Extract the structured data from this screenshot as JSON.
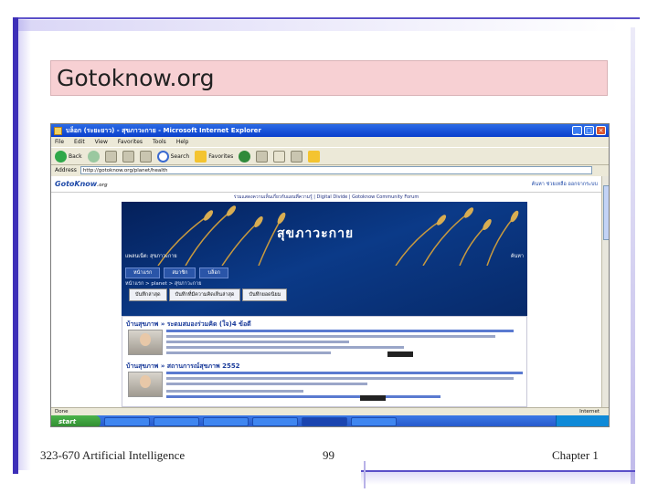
{
  "slide": {
    "title": "Gotoknow.org",
    "footer_left": "323-670 Artificial Intelligence",
    "footer_center": "99",
    "footer_right": "Chapter 1"
  },
  "browser": {
    "window_title": "บล็อก (ระยะยาว) - สุขภาวะกาย - Microsoft Internet Explorer",
    "menu": [
      "File",
      "Edit",
      "View",
      "Favorites",
      "Tools",
      "Help"
    ],
    "toolbar": {
      "back": "Back",
      "search": "Search",
      "favorites": "Favorites"
    },
    "address_label": "Address",
    "address": "http://gotoknow.org/planet/health",
    "status": "Done",
    "status_zone": "Internet",
    "start_label": "start"
  },
  "site": {
    "logo": "GotoKnow",
    "logo_suffix": ".org",
    "header_links": "ค้นหา  ช่วยเหลือ  ออกจากระบบ",
    "announcement": "ร่วมแสดงความเห็นเกี่ยวกับแผนที่ความรู้ | Digital Divide | Gotoknow Community Forum",
    "banner_title": "สุขภาวะกาย",
    "banner_sub": "แพลนเน็ต: สุขภาวะกาย",
    "banner_right": "ค้นหา",
    "nav": [
      "หน้าแรก",
      "สมาชิก",
      "บล็อก"
    ],
    "crumb": "หน้าแรก > planet > สุขภาวะกาย",
    "tabs": [
      "บันทึกล่าสุด",
      "บันทึกที่มีความคิดเห็นล่าสุด",
      "บันทึกยอดนิยม"
    ],
    "posts": [
      {
        "title": "บ้านสุขภาพ » ระดมสมองร่วมคิด (ใจ)4 ข้อดี"
      },
      {
        "title": "บ้านสุขภาพ » สถานการณ์สุขภาพ 2552"
      }
    ]
  }
}
